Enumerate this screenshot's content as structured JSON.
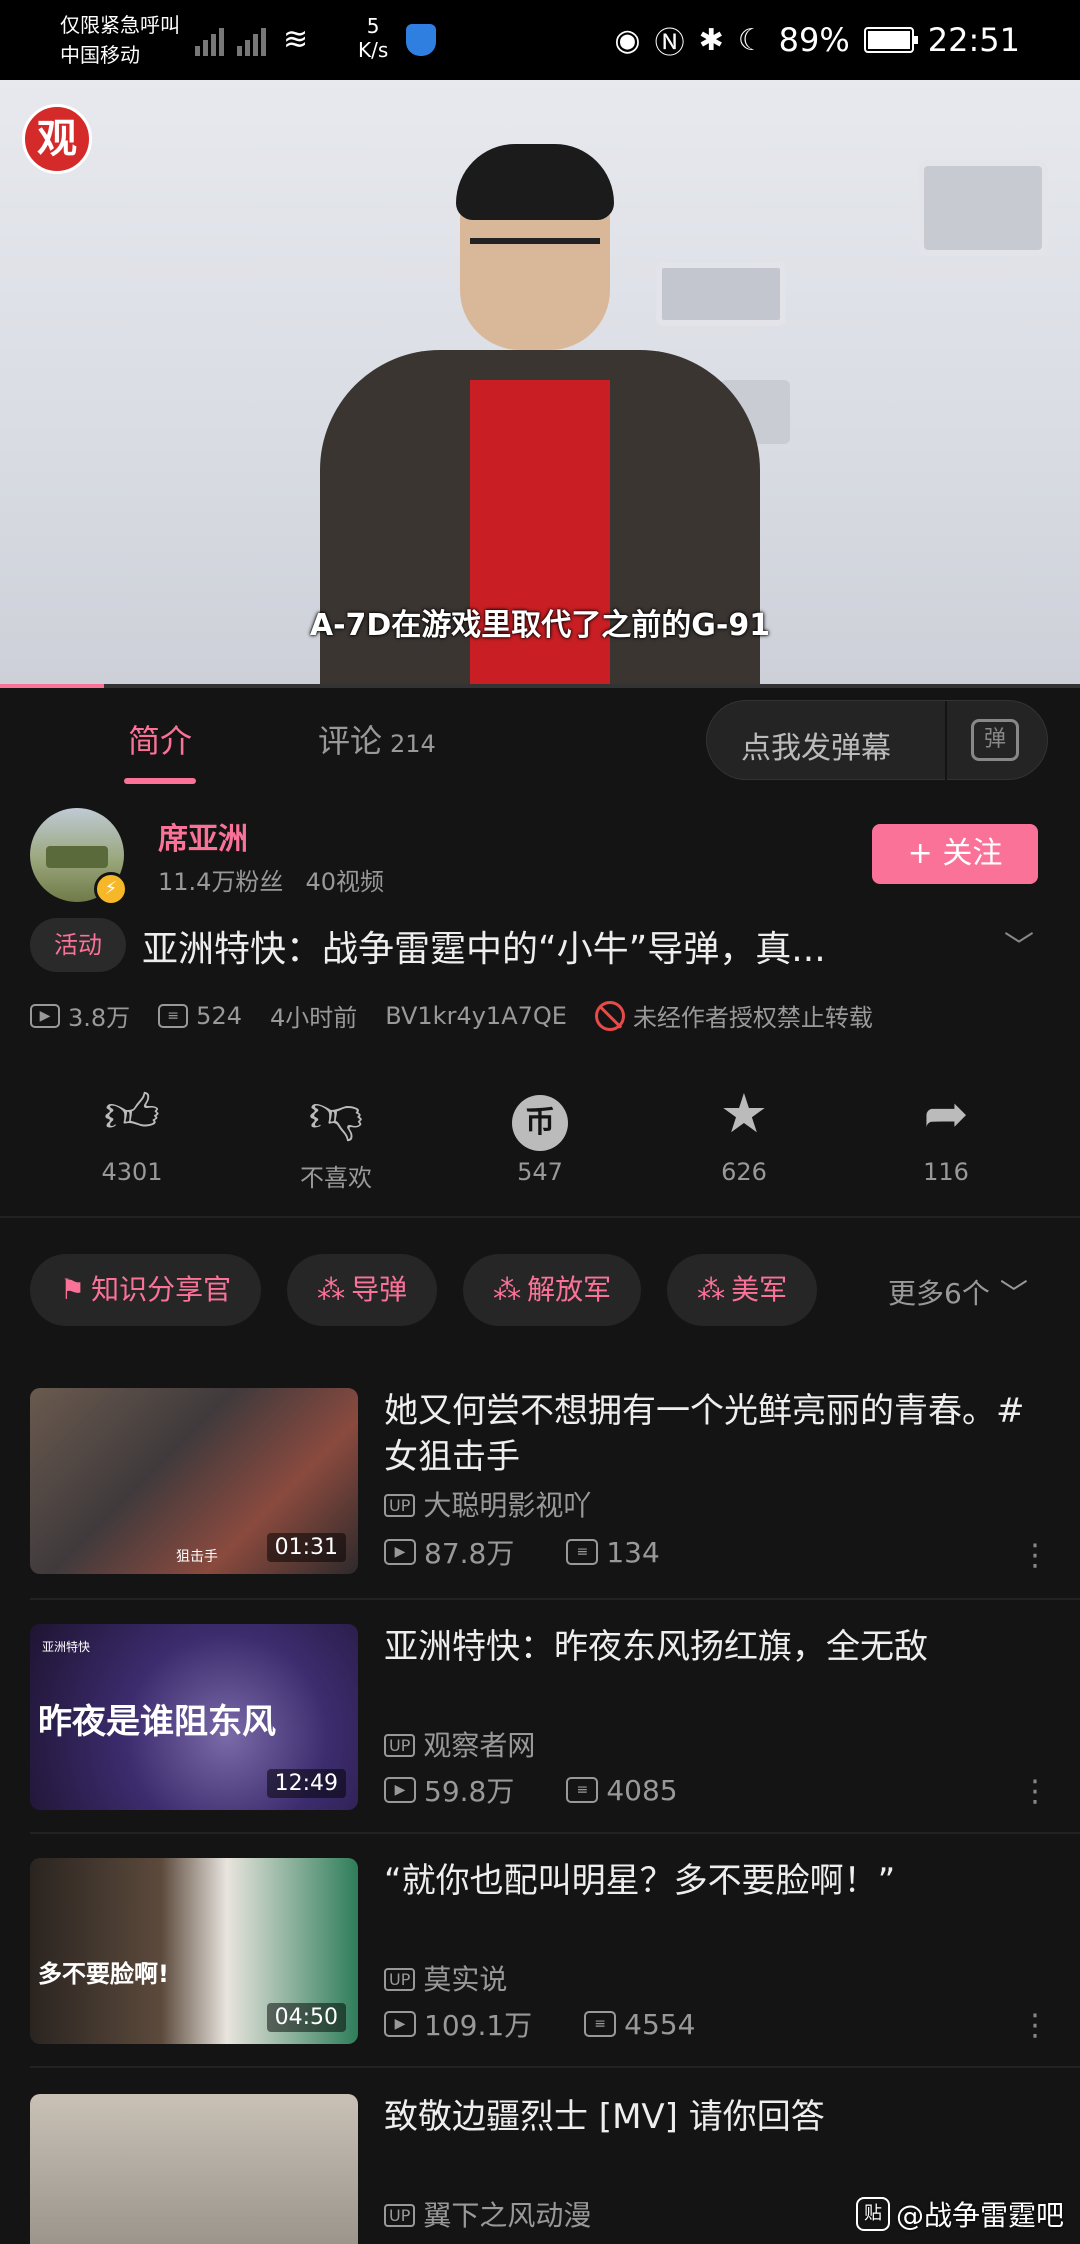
{
  "status_bar": {
    "emergency": "仅限紧急呼叫",
    "carrier": "中国移动",
    "net_speed_value": "5",
    "net_speed_unit": "K/s",
    "battery": "89%",
    "time": "22:51"
  },
  "video": {
    "logo": "观",
    "subtitle": "A-7D在游戏里取代了之前的G-91",
    "progress_fraction": 0.096
  },
  "tabs": {
    "intro": "简介",
    "comments": "评论",
    "comments_count": "214",
    "danmaku_placeholder": "点我发弹幕",
    "danmaku_icon": "弹"
  },
  "uploader": {
    "name": "席亚洲",
    "fans": "11.4万粉丝",
    "videos": "40视频",
    "follow": "+ 关注"
  },
  "video_info": {
    "tag": "活动",
    "title": "亚洲特快：战争雷霆中的“小牛”导弹，真...",
    "plays": "3.8万",
    "danmaku": "524",
    "time": "4小时前",
    "bvid": "BV1kr4y1A7QE",
    "notice": "未经作者授权禁止转载"
  },
  "actions": {
    "like": "4301",
    "dislike": "不喜欢",
    "coin": "547",
    "favorite": "626",
    "share": "116"
  },
  "chips": {
    "items": [
      "知识分享官",
      "导弹",
      "解放军",
      "美军"
    ],
    "more": "更多6个"
  },
  "related": [
    {
      "title": "她又何尝不想拥有一个光鲜亮丽的青春。#女狙击手",
      "uploader": "大聪明影视吖",
      "plays": "87.8万",
      "danmaku": "134",
      "duration": "01:31",
      "thumb_text": "狙击手"
    },
    {
      "title": "亚洲特快：昨夜东风扬红旗，全无敌",
      "uploader": "观察者网",
      "plays": "59.8万",
      "danmaku": "4085",
      "duration": "12:49",
      "thumb_text": "昨夜是谁阻东风",
      "thumb_tag": "亚洲特快"
    },
    {
      "title": "“就你也配叫明星？多不要脸啊！”",
      "uploader": "莫实说",
      "plays": "109.1万",
      "danmaku": "4554",
      "duration": "04:50",
      "thumb_text": "多不要脸啊!"
    },
    {
      "title": "致敬边疆烈士 [MV] 请你回答",
      "uploader": "翼下之风动漫"
    }
  ],
  "watermark": "@战争雷霆吧",
  "watermark_icon": "贴",
  "colors": {
    "accent": "#fb7299",
    "background": "#141414"
  }
}
